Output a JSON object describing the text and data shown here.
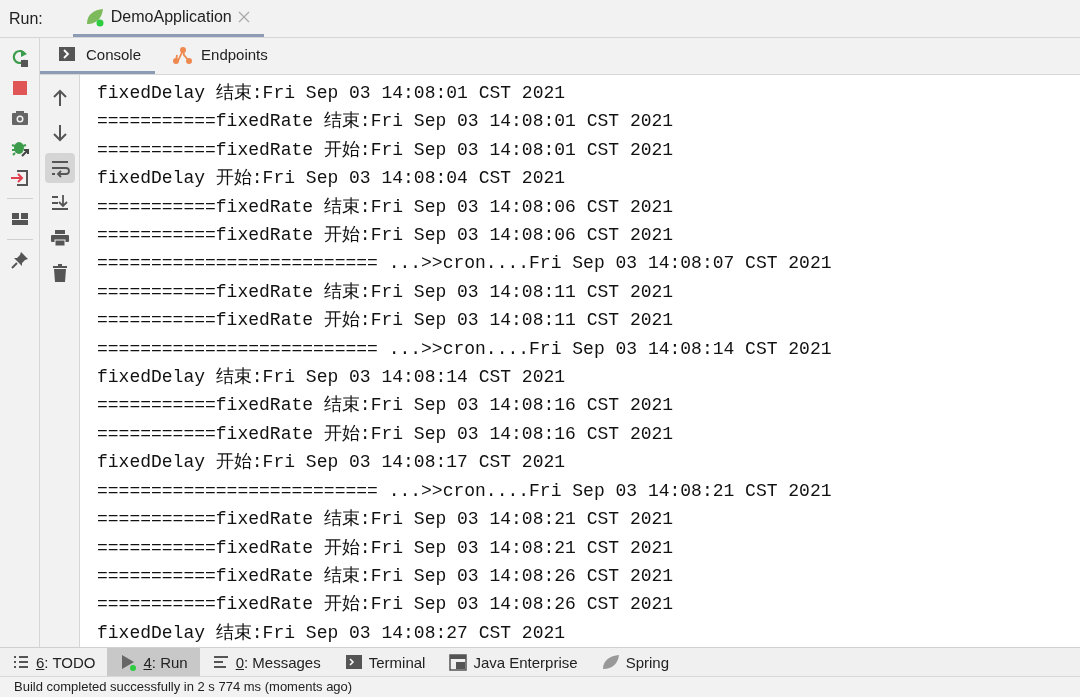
{
  "run_bar": {
    "label": "Run:",
    "tabs": [
      {
        "label": "DemoApplication",
        "selected": true
      }
    ]
  },
  "tool_tabs": [
    {
      "label": "Console",
      "kind": "console",
      "selected": true
    },
    {
      "label": "Endpoints",
      "kind": "endpoints",
      "selected": false
    }
  ],
  "console_toolbar": [
    {
      "kind": "up",
      "selected": false
    },
    {
      "kind": "down",
      "selected": false
    },
    {
      "kind": "wrap",
      "selected": true
    },
    {
      "kind": "scroll-end",
      "selected": false
    },
    {
      "kind": "print",
      "selected": false
    },
    {
      "kind": "trash",
      "selected": false
    }
  ],
  "console_lines": [
    "fixedDelay 结束:Fri Sep 03 14:08:01 CST 2021",
    "===========fixedRate 结束:Fri Sep 03 14:08:01 CST 2021",
    "===========fixedRate 开始:Fri Sep 03 14:08:01 CST 2021",
    "fixedDelay 开始:Fri Sep 03 14:08:04 CST 2021",
    "===========fixedRate 结束:Fri Sep 03 14:08:06 CST 2021",
    "===========fixedRate 开始:Fri Sep 03 14:08:06 CST 2021",
    "========================== ...>>cron....Fri Sep 03 14:08:07 CST 2021",
    "===========fixedRate 结束:Fri Sep 03 14:08:11 CST 2021",
    "===========fixedRate 开始:Fri Sep 03 14:08:11 CST 2021",
    "========================== ...>>cron....Fri Sep 03 14:08:14 CST 2021",
    "fixedDelay 结束:Fri Sep 03 14:08:14 CST 2021",
    "===========fixedRate 结束:Fri Sep 03 14:08:16 CST 2021",
    "===========fixedRate 开始:Fri Sep 03 14:08:16 CST 2021",
    "fixedDelay 开始:Fri Sep 03 14:08:17 CST 2021",
    "========================== ...>>cron....Fri Sep 03 14:08:21 CST 2021",
    "===========fixedRate 结束:Fri Sep 03 14:08:21 CST 2021",
    "===========fixedRate 开始:Fri Sep 03 14:08:21 CST 2021",
    "===========fixedRate 结束:Fri Sep 03 14:08:26 CST 2021",
    "===========fixedRate 开始:Fri Sep 03 14:08:26 CST 2021",
    "fixedDelay 结束:Fri Sep 03 14:08:27 CST 2021"
  ],
  "bottom_tabs": [
    {
      "key": "6",
      "label": ": TODO",
      "kind": "todo",
      "selected": false
    },
    {
      "key": "4",
      "label": ": Run",
      "kind": "run",
      "selected": true
    },
    {
      "key": "0",
      "label": ": Messages",
      "kind": "messages",
      "selected": false
    },
    {
      "label": "Terminal",
      "kind": "terminal",
      "selected": false
    },
    {
      "label": "Java Enterprise",
      "kind": "enterprise",
      "selected": false
    },
    {
      "label": "Spring",
      "kind": "spring",
      "selected": false
    }
  ],
  "status_bar": "Build completed successfully in 2 s 774 ms (moments ago)"
}
